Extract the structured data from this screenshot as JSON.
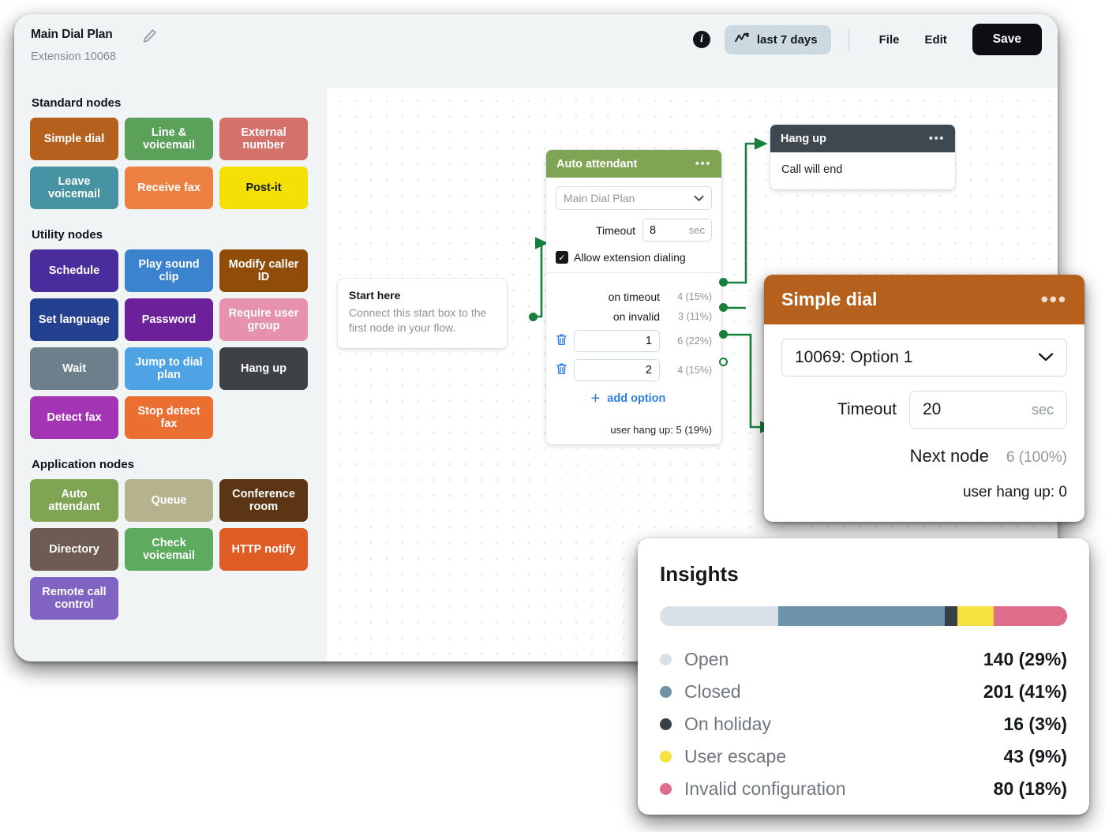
{
  "window": {
    "title": "Main Dial Plan",
    "subtitle": "Extension 10068",
    "edit_icon": "pencil-icon"
  },
  "header": {
    "info_icon": "info-icon",
    "range_icon": "activity-chart-icon",
    "range_label": "last 7 days",
    "file_label": "File",
    "edit_label": "Edit",
    "save_label": "Save"
  },
  "palette": {
    "sections": [
      {
        "heading": "Standard nodes",
        "nodes": [
          {
            "label": "Simple dial",
            "color": "#b5611d",
            "text": "#ffffff"
          },
          {
            "label": "Line & voicemail",
            "color": "#5ba159",
            "text": "#ffffff"
          },
          {
            "label": "External number",
            "color": "#d4716a",
            "text": "#ffffff"
          },
          {
            "label": "Leave voicemail",
            "color": "#4792a3",
            "text": "#ffffff"
          },
          {
            "label": "Receive fax",
            "color": "#ec8040",
            "text": "#ffffff"
          },
          {
            "label": "Post-it",
            "color": "#f5e005",
            "text": "#14181b"
          }
        ]
      },
      {
        "heading": "Utility nodes",
        "nodes": [
          {
            "label": "Schedule",
            "color": "#4a2d9c",
            "text": "#ffffff"
          },
          {
            "label": "Play sound clip",
            "color": "#3b82cf",
            "text": "#ffffff"
          },
          {
            "label": "Modify caller ID",
            "color": "#8f4d09",
            "text": "#ffffff"
          },
          {
            "label": "Set language",
            "color": "#24418f",
            "text": "#ffffff"
          },
          {
            "label": "Password",
            "color": "#6c2099",
            "text": "#ffffff"
          },
          {
            "label": "Require user group",
            "color": "#e691ae",
            "text": "#ffffff"
          },
          {
            "label": "Wait",
            "color": "#6d7f8a",
            "text": "#ffffff"
          },
          {
            "label": "Jump to dial plan",
            "color": "#4ea3e5",
            "text": "#ffffff"
          },
          {
            "label": "Hang up",
            "color": "#3f4244",
            "text": "#ffffff"
          },
          {
            "label": "Detect fax",
            "color": "#a335b4",
            "text": "#ffffff"
          },
          {
            "label": "Stop detect fax",
            "color": "#ec6f32",
            "text": "#ffffff"
          }
        ]
      },
      {
        "heading": "Application nodes",
        "nodes": [
          {
            "label": "Auto attendant",
            "color": "#7fa453",
            "text": "#ffffff"
          },
          {
            "label": "Queue",
            "color": "#b5b38d",
            "text": "#ffffff"
          },
          {
            "label": "Conference room",
            "color": "#5c3514",
            "text": "#ffffff"
          },
          {
            "label": "Directory",
            "color": "#6f5b54",
            "text": "#ffffff"
          },
          {
            "label": "Check voicemail",
            "color": "#5cab5e",
            "text": "#ffffff"
          },
          {
            "label": "HTTP notify",
            "color": "#e05c25",
            "text": "#ffffff"
          },
          {
            "label": "Remote call control",
            "color": "#8163c4",
            "text": "#ffffff"
          }
        ]
      }
    ]
  },
  "canvas": {
    "start_node": {
      "title": "Start here",
      "body": "Connect this start box to the first node in your flow."
    },
    "hangup_node": {
      "title": "Hang up",
      "body": "Call will end",
      "menu_icon": "ellipsis-icon"
    },
    "auto_attendant": {
      "title": "Auto attendant",
      "menu_icon": "ellipsis-icon",
      "dial_plan_value": "Main Dial Plan",
      "timeout_label": "Timeout",
      "timeout_value": "8",
      "timeout_unit": "sec",
      "checkbox_label": "Allow extension dialing",
      "checkbox_checked": true,
      "options": [
        {
          "name": "on timeout",
          "stat": "4 (15%)",
          "kind": "fixed",
          "connected": true
        },
        {
          "name": "on invalid",
          "stat": "3 (11%)",
          "kind": "fixed",
          "connected": true
        },
        {
          "name": "1",
          "stat": "6 (22%)",
          "kind": "input",
          "connected": true
        },
        {
          "name": "2",
          "stat": "4 (15%)",
          "kind": "input",
          "connected": false
        }
      ],
      "add_option_label": "add option",
      "add_icon": "plus-icon",
      "delete_icon": "trash-icon",
      "hangup_stat": "user hang up: 5 (19%)"
    }
  },
  "simple_dial": {
    "title": "Simple dial",
    "menu_icon": "ellipsis-icon",
    "target_value": "10069: Option 1",
    "timeout_label": "Timeout",
    "timeout_value": "20",
    "timeout_unit": "sec",
    "next_node_label": "Next node",
    "next_node_stat": "6 (100%)",
    "hangup_stat": "user hang up: 0",
    "accent": "#b5611d"
  },
  "chart_data": {
    "type": "bar",
    "title": "Insights",
    "categories": [
      "Open",
      "Closed",
      "On holiday",
      "User escape",
      "Invalid configuration"
    ],
    "values": [
      140,
      201,
      16,
      43,
      80
    ],
    "percents": [
      29,
      41,
      3,
      9,
      18
    ],
    "value_labels": [
      "140 (29%)",
      "201 (41%)",
      "16 (3%)",
      "43 (9%)",
      "80 (18%)"
    ],
    "colors": [
      "#d9e1e8",
      "#6d93a8",
      "#364049",
      "#f5e13f",
      "#dd6d8a"
    ],
    "xlabel": "",
    "ylabel": "",
    "legend_position": "below",
    "grid": false
  }
}
